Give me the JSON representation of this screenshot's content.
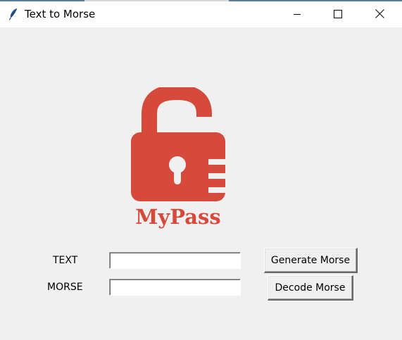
{
  "window": {
    "title": "Text to Morse",
    "icon": "feather-icon",
    "controls": [
      "minimize-icon",
      "maximize-icon",
      "close-icon"
    ]
  },
  "logo": {
    "text": "MyPass",
    "icon": "open-padlock-icon",
    "color": "#d64a3b"
  },
  "form": {
    "text_label": "TEXT",
    "morse_label": "MORSE",
    "text_value": "",
    "morse_value": ""
  },
  "buttons": {
    "generate_label": "Generate Morse",
    "decode_label": "Decode Morse"
  }
}
